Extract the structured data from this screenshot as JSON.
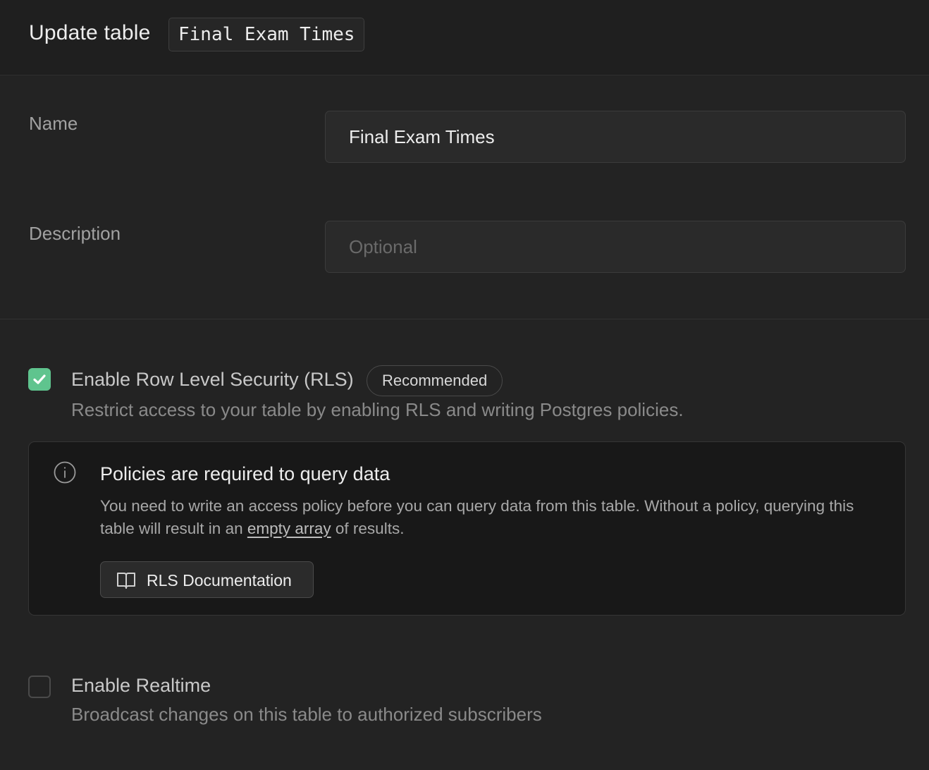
{
  "header": {
    "title": "Update table",
    "table_name": "Final Exam Times"
  },
  "form": {
    "name_label": "Name",
    "name_value": "Final Exam Times",
    "description_label": "Description",
    "description_value": "",
    "description_placeholder": "Optional"
  },
  "rls": {
    "checked": true,
    "title": "Enable Row Level Security (RLS)",
    "badge": "Recommended",
    "description": "Restrict access to your table by enabling RLS and writing Postgres policies."
  },
  "alert": {
    "icon": "info-icon",
    "title": "Policies are required to query data",
    "body_before": "You need to write an access policy before you can query data from this table. Without a policy, querying this table will result in an ",
    "body_link": "empty array",
    "body_after": " of results.",
    "button_icon": "book-icon",
    "button_label": "RLS Documentation"
  },
  "realtime": {
    "checked": false,
    "title": "Enable Realtime",
    "description": "Broadcast changes on this table to authorized subscribers"
  },
  "colors": {
    "background": "#232323",
    "checkbox_checked": "#5fc48e",
    "alert_background": "#181818"
  }
}
